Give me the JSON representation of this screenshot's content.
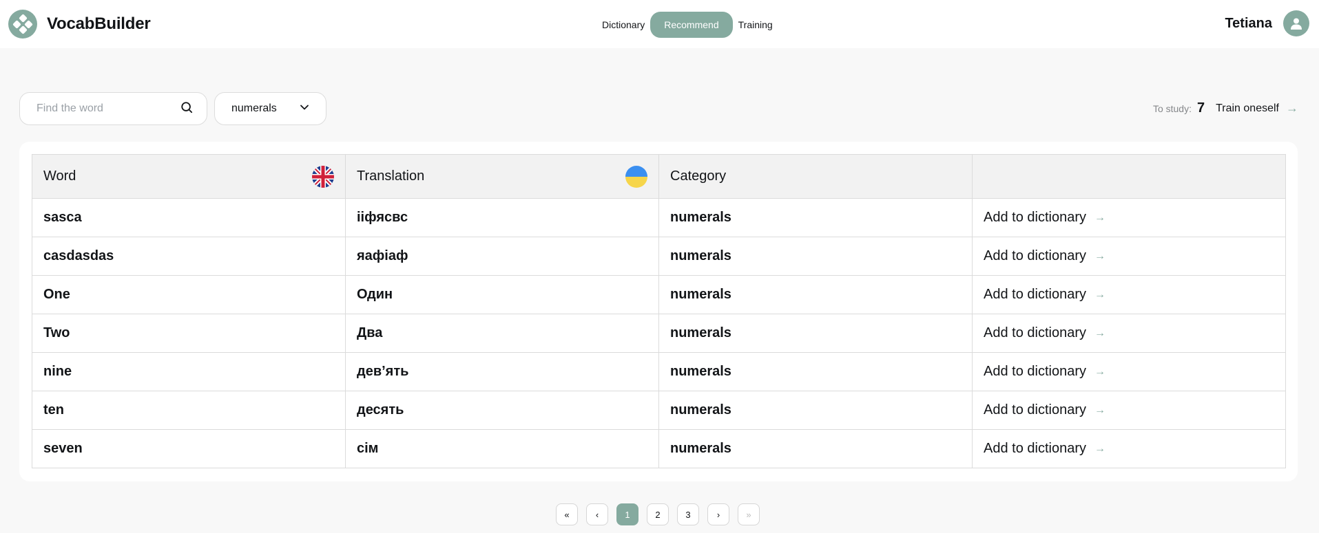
{
  "app": {
    "name": "VocabBuilder"
  },
  "nav": {
    "items": [
      "Dictionary",
      "Recommend",
      "Training"
    ],
    "active_index": 1
  },
  "user": {
    "name": "Tetiana"
  },
  "toolbar": {
    "search_placeholder": "Find the word",
    "category_selected": "numerals",
    "to_study_label": "To study:",
    "to_study_count": "7",
    "train_label": "Train oneself"
  },
  "table": {
    "headers": [
      "Word",
      "Translation",
      "Category",
      ""
    ],
    "rows": [
      {
        "word": "sasca",
        "translation": "iiфясвс",
        "category": "numerals",
        "action": "Add to dictionary"
      },
      {
        "word": "casdasdas",
        "translation": "яафіаф",
        "category": "numerals",
        "action": "Add to dictionary"
      },
      {
        "word": "One",
        "translation": "Один",
        "category": "numerals",
        "action": "Add to dictionary"
      },
      {
        "word": "Two",
        "translation": "Два",
        "category": "numerals",
        "action": "Add to dictionary"
      },
      {
        "word": "nine",
        "translation": "дев’ять",
        "category": "numerals",
        "action": "Add to dictionary"
      },
      {
        "word": "ten",
        "translation": "десять",
        "category": "numerals",
        "action": "Add to dictionary"
      },
      {
        "word": "seven",
        "translation": "сім",
        "category": "numerals",
        "action": "Add to dictionary"
      }
    ]
  },
  "pagination": {
    "first": "«",
    "prev": "‹",
    "pages": [
      "1",
      "2",
      "3"
    ],
    "current": "1",
    "next": "›",
    "last": "»"
  },
  "icons": {
    "logo": "logo-icon",
    "search": "search-icon",
    "chevron": "chevron-down-icon",
    "arrow": "arrow-right-icon",
    "user": "user-icon",
    "flag_en": "uk-flag-icon",
    "flag_ua": "ukraine-flag-icon"
  },
  "colors": {
    "accent": "#85aa9f",
    "text": "#121417",
    "background": "#f8f8f8"
  }
}
